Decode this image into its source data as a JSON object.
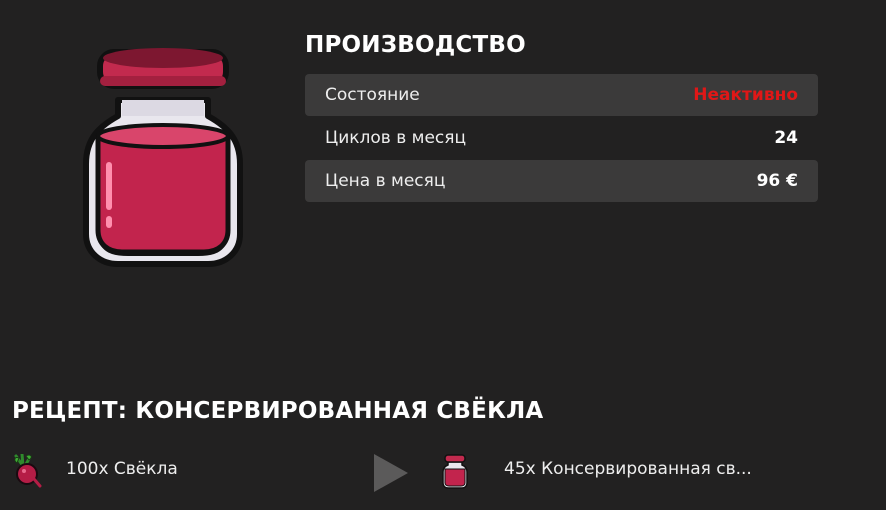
{
  "production": {
    "title": "ПРОИЗВОДСТВО",
    "rows": [
      {
        "label": "Состояние",
        "value": "Неактивно",
        "value_color": "#e01717"
      },
      {
        "label": "Циклов в месяц",
        "value": "24"
      },
      {
        "label": "Цена в месяц",
        "value": "96 €"
      }
    ],
    "product_icon": "beet-jar-icon"
  },
  "recipe": {
    "title": "РЕЦЕПТ: КОНСЕРВИРОВАННАЯ СВЁКЛА",
    "input": {
      "icon": "beet-icon",
      "label": "100x Свёкла"
    },
    "arrow_icon": "play-arrow-icon",
    "output": {
      "icon": "beet-jar-icon",
      "label": "45x Консервированная св..."
    }
  },
  "colors": {
    "background": "#222121",
    "row_shade": "#3b3a3a",
    "inactive": "#e01717",
    "jar_liquid": "#c2244d",
    "jar_lid": "#c22a4e"
  }
}
